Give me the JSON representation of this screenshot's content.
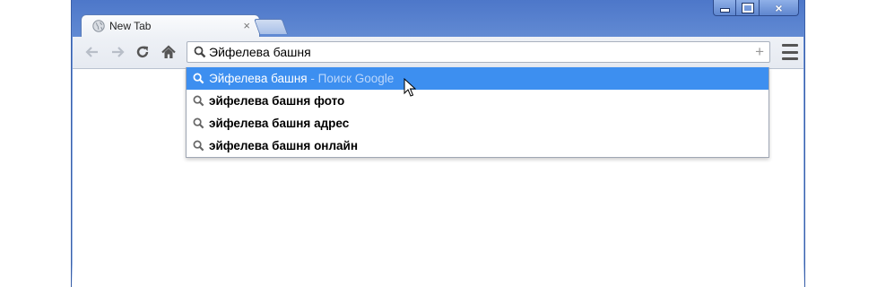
{
  "tab": {
    "title": "New Tab",
    "close_glyph": "×",
    "icon": "globe-icon"
  },
  "toolbar": {
    "back_icon": "back-arrow-icon",
    "forward_icon": "forward-arrow-icon",
    "reload_icon": "reload-icon",
    "home_icon": "home-icon",
    "menu_icon": "menu-icon"
  },
  "omnibox": {
    "value": "Эйфелева башня",
    "plus_glyph": "+"
  },
  "suggestions": [
    {
      "text": "Эйфелева башня",
      "hint": "- Поиск Google",
      "selected": true,
      "bold": false
    },
    {
      "text": "эйфелева башня фото",
      "hint": "",
      "selected": false,
      "bold": true
    },
    {
      "text": "эйфелева башня адрес",
      "hint": "",
      "selected": false,
      "bold": true
    },
    {
      "text": "эйфелева башня онлайн",
      "hint": "",
      "selected": false,
      "bold": true
    }
  ],
  "window_controls": {
    "close_glyph": "×"
  },
  "colors": {
    "frame": "#6b93d8",
    "selection": "#3d8ff0",
    "hint": "#bcd7fb"
  }
}
